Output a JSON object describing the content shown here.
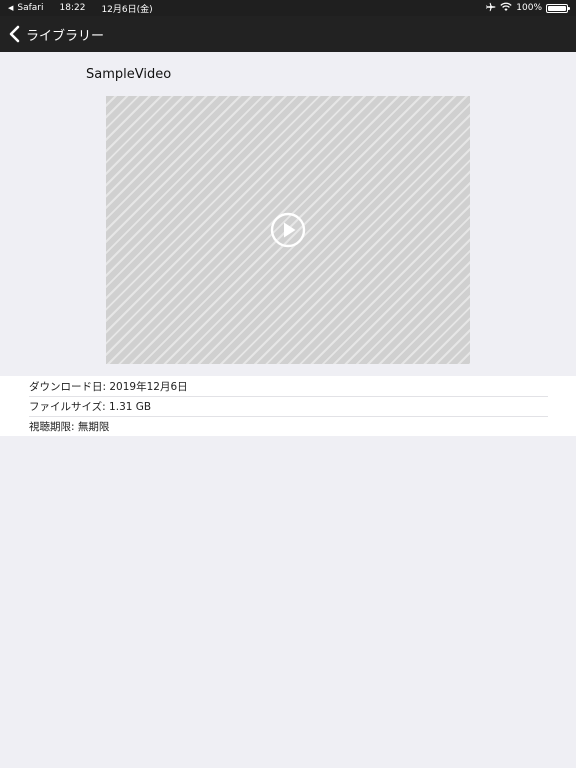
{
  "status_bar": {
    "back_app": "Safari",
    "time": "18:22",
    "date": "12月6日(金)",
    "battery": "100%",
    "icons": [
      "airplane-icon",
      "wifi-icon",
      "battery-icon"
    ]
  },
  "nav": {
    "back_label": "ライブラリー"
  },
  "video": {
    "title": "SampleVideo"
  },
  "details": [
    {
      "text": "ダウンロード日: 2019年12月6日"
    },
    {
      "text": "ファイルサイズ: 1.31 GB"
    },
    {
      "text": "視聴期限: 無期限"
    }
  ],
  "colors": {
    "background": "#efeff4",
    "navbar": "#222222",
    "statusbar": "#1f1f1f"
  }
}
